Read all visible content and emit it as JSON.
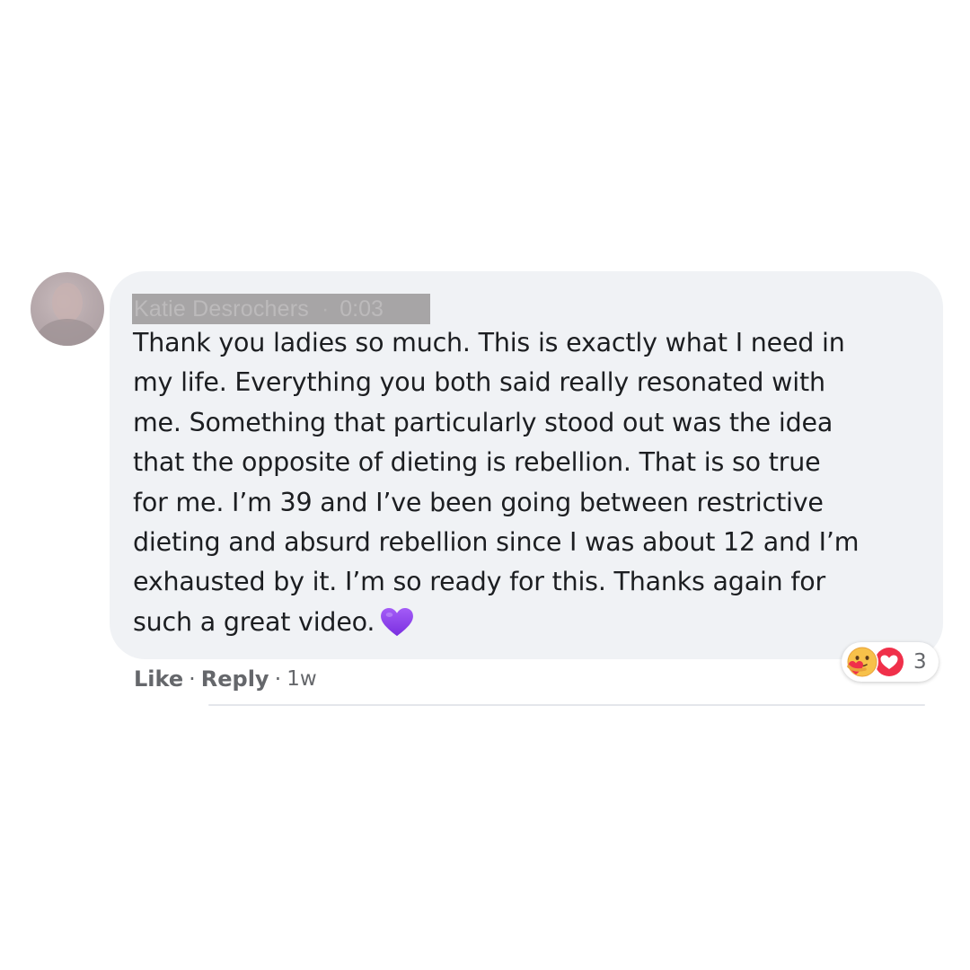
{
  "comment": {
    "author_name": "Katie Desrochers",
    "author_separator": "·",
    "author_time": "0:03",
    "text_lines": [
      "Thank you ladies so much. This is exactly what I need in",
      "my life. Everything you both said really resonated with",
      "me. Something that particularly stood out was the idea",
      "that the opposite of dieting is rebellion. That is so true",
      "for me. I’m 39 and I’ve been going between restrictive",
      "dieting and absurd rebellion since I was about 12 and I’m",
      "exhausted by it. I’m so ready for this. Thanks again for",
      "such a great video."
    ],
    "trailing_emoji": "purple-heart-icon",
    "actions": {
      "like_label": "Like",
      "separator": "·",
      "reply_label": "Reply",
      "time_label": "1w"
    },
    "reactions": {
      "icons": [
        "care-reaction-icon",
        "love-reaction-icon"
      ],
      "count": "3"
    }
  },
  "colors": {
    "bubble_bg": "#f0f2f5",
    "text": "#1c1e21",
    "meta_text": "#65676b",
    "redaction_bar": "#a7a5a6",
    "purple_heart": "#8e3ff0",
    "love_red": "#f0304a",
    "care_yellow": "#f7c14a"
  }
}
